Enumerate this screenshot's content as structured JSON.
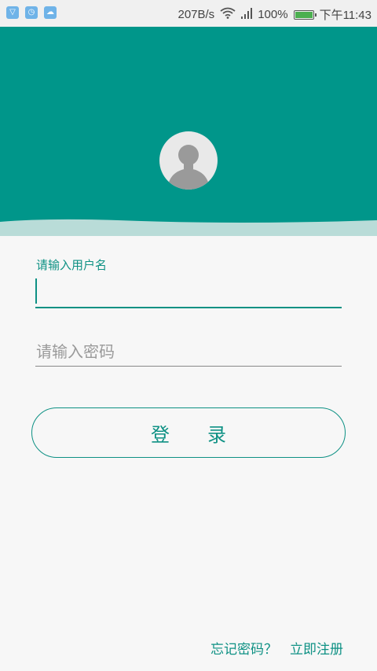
{
  "status_bar": {
    "network_speed": "207B/s",
    "battery_percent": "100%",
    "time": "下午11:43",
    "battery_level": 1.0,
    "left_icons": [
      "message-icon",
      "alarm-icon",
      "cloud-icon"
    ]
  },
  "colors": {
    "accent": "#0e9184",
    "header_teal": "#00968a",
    "background": "#f7f7f7"
  },
  "form": {
    "username_label": "请输入用户名",
    "username_value": "",
    "password_placeholder": "请输入密码",
    "login_label": "登　　录"
  },
  "links": {
    "forgot_password": "忘记密码？",
    "register": "立即注册"
  }
}
